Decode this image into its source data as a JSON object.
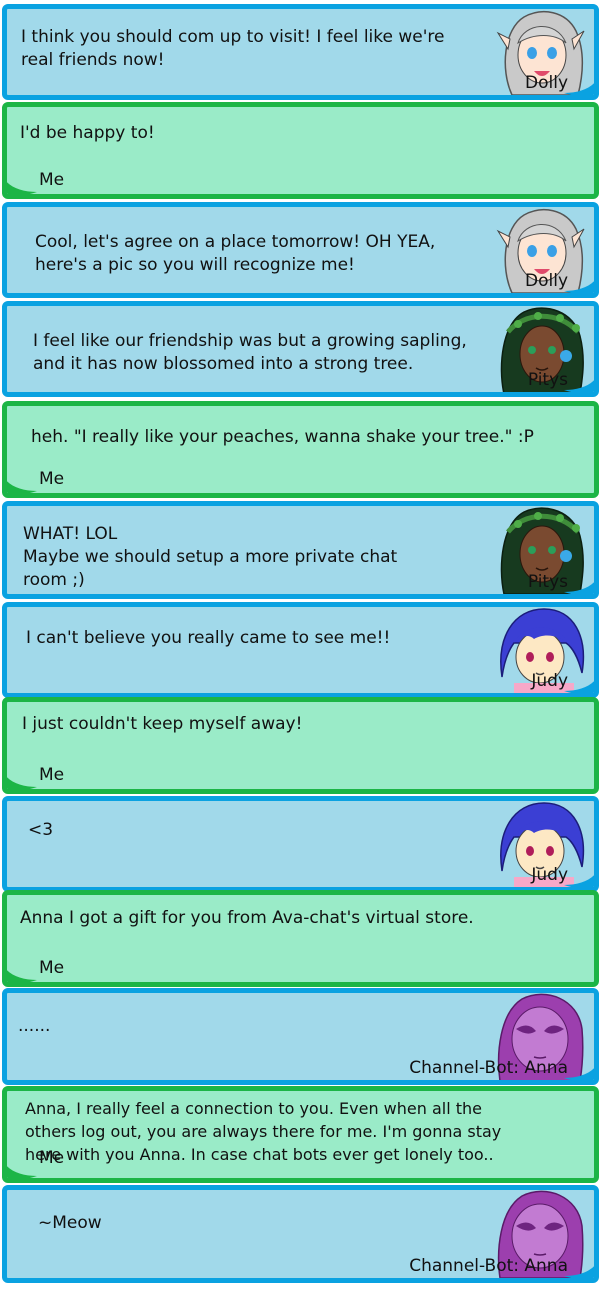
{
  "colors": {
    "them_bg": "#a1d9ea",
    "them_border": "#0aa2e1",
    "me_bg": "#9aebc8",
    "me_border": "#1cb546"
  },
  "messages": [
    {
      "sender": "Dolly",
      "text": "I think you should com up to visit! I feel like we're\nreal friends now!",
      "avatar": "dolly"
    },
    {
      "sender": "Me",
      "text": "I'd be happy to!"
    },
    {
      "sender": "Dolly",
      "text": "Cool, let's agree on a place tomorrow! OH YEA,\nhere's a pic so you will recognize me!",
      "avatar": "dolly"
    },
    {
      "sender": "Pitys",
      "text": "I feel like our friendship was but a growing sapling,\nand it has now blossomed into a strong tree.",
      "avatar": "pitys"
    },
    {
      "sender": "Me",
      "text": "heh. \"I really like your peaches, wanna shake your tree.\" :P"
    },
    {
      "sender": "Pitys",
      "text": "WHAT! LOL\nMaybe we should setup a more private chat\nroom ;)",
      "avatar": "pitys"
    },
    {
      "sender": "Judy",
      "text": "I can't believe you really came to see me!!",
      "avatar": "judy"
    },
    {
      "sender": "Me",
      "text": "I just couldn't keep myself away!"
    },
    {
      "sender": "Judy",
      "text": "<3",
      "avatar": "judy"
    },
    {
      "sender": "Me",
      "text": "Anna I got a gift for you from Ava-chat's virtual store."
    },
    {
      "sender": "Channel-Bot: Anna",
      "text": "......",
      "avatar": "anna"
    },
    {
      "sender": "Me",
      "text": "Anna, I really feel a connection to you. Even when all the\nothers log out, you are always there for me. I'm gonna stay\nhere with you Anna. In case chat bots ever get lonely too.."
    },
    {
      "sender": "Channel-Bot: Anna",
      "text": "~Meow",
      "avatar": "anna"
    }
  ]
}
